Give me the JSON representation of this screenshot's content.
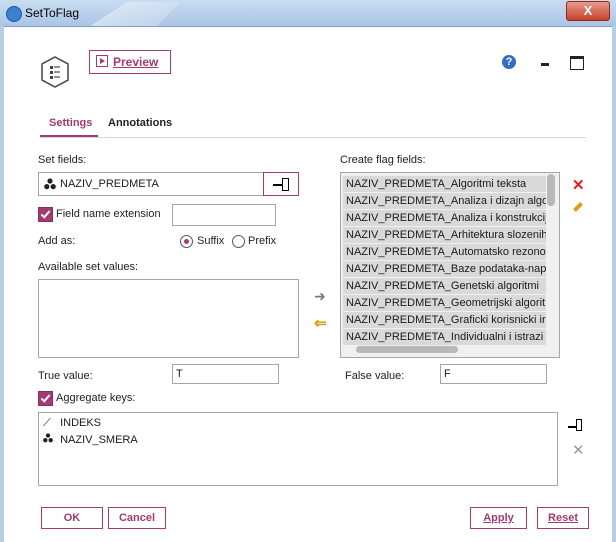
{
  "window": {
    "title": "SetToFlag",
    "close_label": "X"
  },
  "toolbar": {
    "preview_label": "Preview",
    "help_label": "?"
  },
  "tabs": [
    {
      "label": "Settings"
    },
    {
      "label": "Annotations"
    }
  ],
  "settings": {
    "set_fields_label": "Set fields:",
    "set_field_value": "NAZIV_PREDMETA",
    "field_name_extension_label": "Field name extension",
    "field_name_extension_value": "",
    "add_as_label": "Add as:",
    "suffix_label": "Suffix",
    "prefix_label": "Prefix",
    "add_as_selected": "Suffix",
    "available_set_values_label": "Available set values:",
    "create_flag_fields_label": "Create flag fields:",
    "flag_fields": [
      "NAZIV_PREDMETA_Algoritmi teksta",
      "NAZIV_PREDMETA_Analiza i dizajn algo",
      "NAZIV_PREDMETA_Analiza i konstrukcij",
      "NAZIV_PREDMETA_Arhitektura slozenih",
      "NAZIV_PREDMETA_Automatsko rezonov",
      "NAZIV_PREDMETA_Baze podataka-nap",
      "NAZIV_PREDMETA_Genetski algoritmi",
      "NAZIV_PREDMETA_Geometrijski algorit",
      "NAZIV_PREDMETA_Graficki korisnicki ir",
      "NAZIV_PREDMETA_Individualni i istrazi"
    ],
    "true_value_label": "True value:",
    "true_value": "T",
    "false_value_label": "False value:",
    "false_value": "F",
    "aggregate_keys_label": "Aggregate keys:",
    "aggregate_keys": [
      "INDEKS",
      "NAZIV_SMERA"
    ]
  },
  "footer": {
    "ok_label": "OK",
    "cancel_label": "Cancel",
    "apply_label": "Apply",
    "reset_label": "Reset"
  },
  "colors": {
    "accent": "#a23b72",
    "title_bar": "#c9dcf1",
    "delete": "#e02020"
  }
}
